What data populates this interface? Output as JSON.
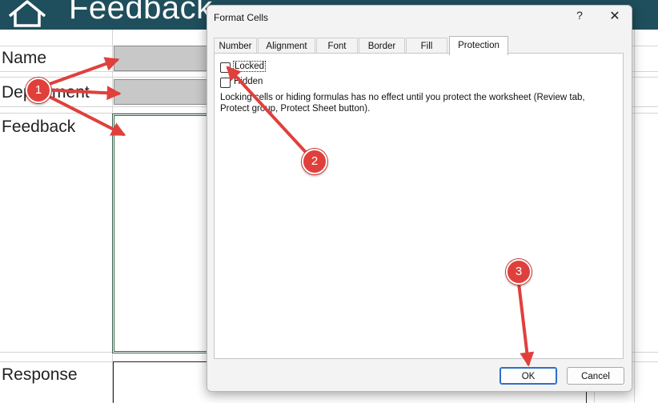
{
  "sheet": {
    "title": "Feedback",
    "labels": {
      "name": "Name",
      "department": "Department",
      "feedback": "Feedback",
      "response": "Response"
    }
  },
  "dialog": {
    "title": "Format Cells",
    "help_label": "?",
    "close_label": "✕",
    "tabs": [
      {
        "label": "Number",
        "active": false
      },
      {
        "label": "Alignment",
        "active": false
      },
      {
        "label": "Font",
        "active": false
      },
      {
        "label": "Border",
        "active": false
      },
      {
        "label": "Fill",
        "active": false
      },
      {
        "label": "Protection",
        "active": true
      }
    ],
    "protection": {
      "locked_label": "Locked",
      "locked_checked": false,
      "hidden_label": "Hidden",
      "hidden_checked": false,
      "info_text": "Locking cells or hiding formulas has no effect until you protect the worksheet (Review tab, Protect group, Protect Sheet button)."
    },
    "buttons": {
      "ok": "OK",
      "cancel": "Cancel"
    }
  },
  "annotations": {
    "markers": [
      "1",
      "2",
      "3"
    ],
    "color": "#e0403c"
  }
}
